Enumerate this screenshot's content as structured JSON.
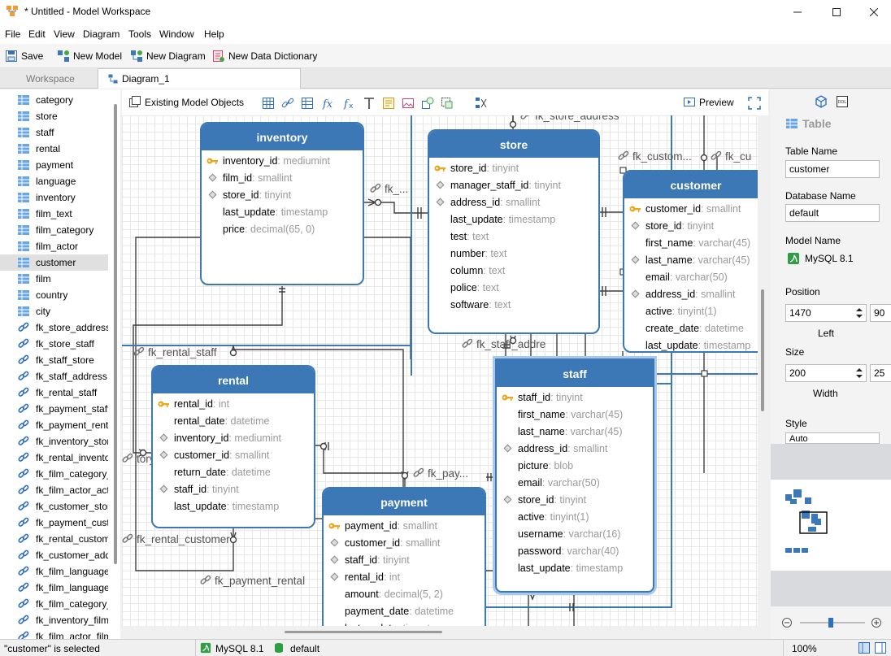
{
  "window": {
    "title": "* Untitled - Model Workspace"
  },
  "menu": [
    "File",
    "Edit",
    "View",
    "Diagram",
    "Tools",
    "Window",
    "Help"
  ],
  "toolbar": {
    "save": "Save",
    "new_model": "New Model",
    "new_diagram": "New Diagram",
    "new_dictionary": "New Data Dictionary"
  },
  "tabs": {
    "workspace": "Workspace",
    "diagram": "Diagram_1"
  },
  "sidebar": {
    "tables": [
      "category",
      "store",
      "staff",
      "rental",
      "payment",
      "language",
      "inventory",
      "film_text",
      "film_category",
      "film_actor",
      "customer",
      "film",
      "country",
      "city"
    ],
    "relations": [
      "fk_store_address",
      "fk_store_staff",
      "fk_staff_store",
      "fk_staff_address",
      "fk_rental_staff",
      "fk_payment_staff",
      "fk_payment_rent",
      "fk_inventory_stor",
      "fk_rental_invento",
      "fk_film_category_",
      "fk_film_actor_act",
      "fk_customer_stor",
      "fk_payment_cust",
      "fk_rental_custom",
      "fk_customer_add",
      "fk_film_language",
      "fk_film_language",
      "fk_film_category_",
      "fk_inventory_film",
      "fk_film_actor_film"
    ],
    "selected": "customer"
  },
  "canvas_toolbar": {
    "existing": "Existing Model Objects",
    "preview": "Preview"
  },
  "entities": {
    "inventory": {
      "title": "inventory",
      "fields": [
        {
          "n": "inventory_id",
          "t": " : mediumint",
          "m": "key"
        },
        {
          "n": "film_id",
          "t": " : smallint",
          "m": "dia"
        },
        {
          "n": "store_id",
          "t": " : tinyint",
          "m": "dia"
        },
        {
          "n": "last_update",
          "t": " : timestamp",
          "m": ""
        },
        {
          "n": "price",
          "t": " : decimal(65, 0)",
          "m": ""
        }
      ]
    },
    "store": {
      "title": "store",
      "fields": [
        {
          "n": "store_id",
          "t": " : tinyint",
          "m": "key"
        },
        {
          "n": "manager_staff_id",
          "t": " : tinyint",
          "m": "dia"
        },
        {
          "n": "address_id",
          "t": " : smallint",
          "m": "dia"
        },
        {
          "n": "last_update",
          "t": " : timestamp",
          "m": ""
        },
        {
          "n": "test",
          "t": " : text",
          "m": ""
        },
        {
          "n": "number",
          "t": " : text",
          "m": ""
        },
        {
          "n": "column",
          "t": " : text",
          "m": ""
        },
        {
          "n": "police",
          "t": " : text",
          "m": ""
        },
        {
          "n": "software",
          "t": " : text",
          "m": ""
        }
      ]
    },
    "customer": {
      "title": "customer",
      "fields": [
        {
          "n": "customer_id",
          "t": " : smallint",
          "m": "key"
        },
        {
          "n": "store_id",
          "t": " : tinyint",
          "m": "dia"
        },
        {
          "n": "first_name",
          "t": " : varchar(45)",
          "m": ""
        },
        {
          "n": "last_name",
          "t": " : varchar(45)",
          "m": "dia"
        },
        {
          "n": "email",
          "t": " : varchar(50)",
          "m": ""
        },
        {
          "n": "address_id",
          "t": " : smallint",
          "m": "dia"
        },
        {
          "n": "active",
          "t": " : tinyint(1)",
          "m": ""
        },
        {
          "n": "create_date",
          "t": " : datetime",
          "m": ""
        },
        {
          "n": "last_update",
          "t": " : timestamp",
          "m": ""
        }
      ]
    },
    "rental": {
      "title": "rental",
      "fields": [
        {
          "n": "rental_id",
          "t": " : int",
          "m": "key"
        },
        {
          "n": "rental_date",
          "t": " : datetime",
          "m": ""
        },
        {
          "n": "inventory_id",
          "t": " : mediumint",
          "m": "dia"
        },
        {
          "n": "customer_id",
          "t": " : smallint",
          "m": "dia"
        },
        {
          "n": "return_date",
          "t": " : datetime",
          "m": ""
        },
        {
          "n": "staff_id",
          "t": " : tinyint",
          "m": "dia"
        },
        {
          "n": "last_update",
          "t": " : timestamp",
          "m": ""
        }
      ]
    },
    "staff": {
      "title": "staff",
      "fields": [
        {
          "n": "staff_id",
          "t": " : tinyint",
          "m": "key"
        },
        {
          "n": "first_name",
          "t": " : varchar(45)",
          "m": ""
        },
        {
          "n": "last_name",
          "t": " : varchar(45)",
          "m": ""
        },
        {
          "n": "address_id",
          "t": " : smallint",
          "m": "dia"
        },
        {
          "n": "picture",
          "t": " : blob",
          "m": ""
        },
        {
          "n": "email",
          "t": " : varchar(50)",
          "m": ""
        },
        {
          "n": "store_id",
          "t": " : tinyint",
          "m": "dia"
        },
        {
          "n": "active",
          "t": " : tinyint(1)",
          "m": ""
        },
        {
          "n": "username",
          "t": " : varchar(16)",
          "m": ""
        },
        {
          "n": "password",
          "t": " : varchar(40)",
          "m": ""
        },
        {
          "n": "last_update",
          "t": " : timestamp",
          "m": ""
        }
      ]
    },
    "payment": {
      "title": "payment",
      "fields": [
        {
          "n": "payment_id",
          "t": " : smallint",
          "m": "key"
        },
        {
          "n": "customer_id",
          "t": " : smallint",
          "m": "dia"
        },
        {
          "n": "staff_id",
          "t": " : tinyint",
          "m": "dia"
        },
        {
          "n": "rental_id",
          "t": " : int",
          "m": "dia"
        },
        {
          "n": "amount",
          "t": " : decimal(5, 2)",
          "m": ""
        },
        {
          "n": "payment_date",
          "t": " : datetime",
          "m": ""
        },
        {
          "n": "last_update",
          "t": " : timestamp",
          "m": ""
        }
      ]
    }
  },
  "canvas_labels": {
    "fk_store_address": "fk_store_address",
    "fk_custom": "fk_custom...",
    "fk_cu": "fk_cu",
    "fk_dots": "fk_...",
    "fk_rental_staff": "fk_rental_staff",
    "fk_staff_addre": "fk_staff_addre",
    "tory": "tory",
    "fk_pay": "fk_pay...",
    "fk_rental_customer": "fk_rental_customer",
    "fk_payment_rental": "fk_payment_rental"
  },
  "panel": {
    "heading": "Table",
    "table_name_lbl": "Table Name",
    "table_name": "customer",
    "db_name_lbl": "Database Name",
    "db_name": "default",
    "model_name_lbl": "Model Name",
    "model_name": "MySQL 8.1",
    "position_lbl": "Position",
    "left_val": "1470",
    "top_val": "90",
    "left_lbl": "Left",
    "size_lbl": "Size",
    "width_val": "200",
    "height_val": "25",
    "width_lbl": "Width",
    "style_lbl": "Style",
    "style_val": "Auto"
  },
  "status": {
    "selected": "\"customer\" is selected",
    "db": "MySQL 8.1",
    "schema": "default",
    "zoom": "100%"
  },
  "colors": {
    "accent": "#3b78b5",
    "selection": "#a9c8ef"
  }
}
